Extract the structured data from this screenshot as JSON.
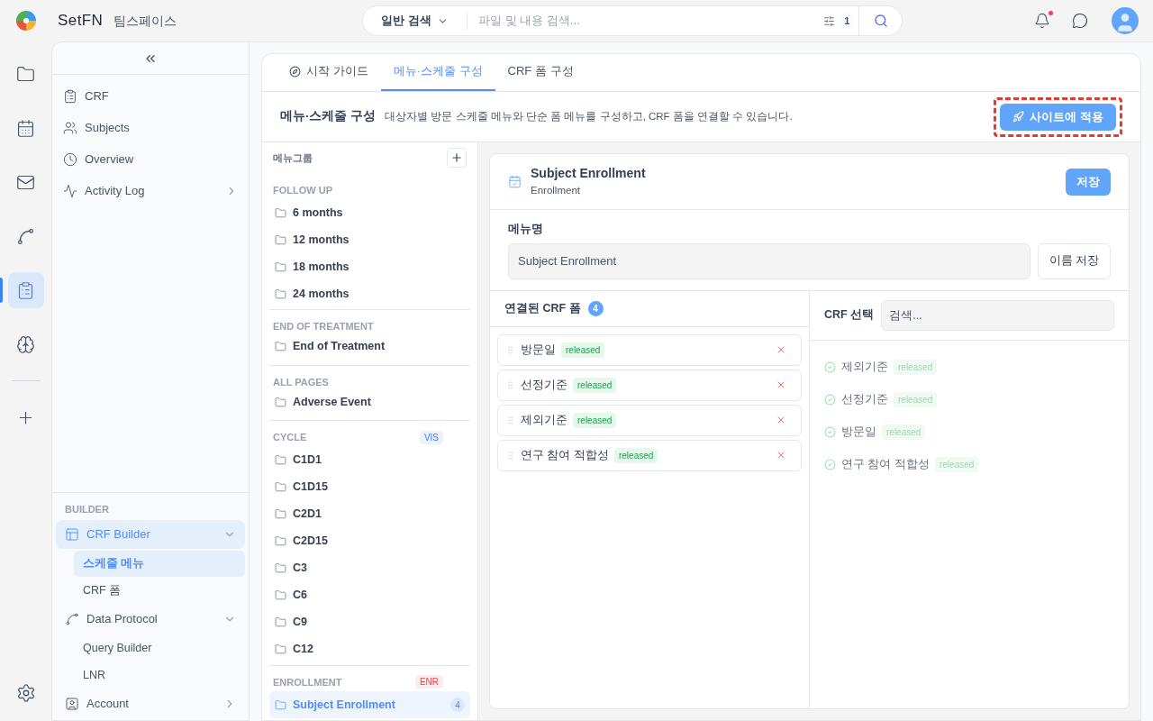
{
  "topbar": {
    "brand": "SetFN",
    "workspace": "팀스페이스",
    "search": {
      "mode": "일반 검색",
      "placeholder": "파일 및 내용 검색...",
      "filter_count": "1"
    },
    "notifications_unread": true
  },
  "rail": [
    {
      "kind": "folder",
      "selected": false
    },
    {
      "kind": "calendar",
      "selected": false
    },
    {
      "kind": "mail",
      "selected": false
    },
    {
      "kind": "route",
      "selected": false
    },
    {
      "kind": "clipboard",
      "selected": true
    },
    {
      "kind": "brain",
      "selected": false
    },
    {
      "kind": "plus",
      "selected": false
    }
  ],
  "sidebar": {
    "items": [
      {
        "label": "CRF",
        "kind": "clipboard"
      },
      {
        "label": "Subjects",
        "kind": "users"
      },
      {
        "label": "Overview",
        "kind": "clock"
      },
      {
        "label": "Activity Log",
        "kind": "activity",
        "expanded": false
      }
    ],
    "builder": {
      "heading": "BUILDER",
      "items": [
        {
          "label": "CRF Builder",
          "kind": "table",
          "selected": true,
          "expanded": true,
          "children": [
            {
              "label": "스케줄 메뉴",
              "selected": true
            },
            {
              "label": "CRF 폼",
              "selected": false
            }
          ]
        },
        {
          "label": "Data Protocol",
          "kind": "route",
          "selected": false,
          "expanded": true,
          "children": [
            {
              "label": "Query Builder",
              "selected": false
            },
            {
              "label": "LNR",
              "selected": false
            }
          ]
        },
        {
          "label": "Account",
          "kind": "user",
          "selected": false,
          "expanded": false
        }
      ]
    }
  },
  "tabs": [
    {
      "label": "시작 가이드",
      "kind": "guide",
      "selected": false
    },
    {
      "label": "메뉴·스케줄 구성",
      "kind": "plain",
      "selected": true
    },
    {
      "label": "CRF 폼 구성",
      "kind": "plain",
      "selected": false
    }
  ],
  "header": {
    "title": "메뉴·스케줄 구성",
    "description": "대상자별 방문 스케줄 메뉴와 단순 폼 메뉴를 구성하고, CRF 폼을 연결할 수 있습니다.",
    "apply_button": "사이트에 적용",
    "highlighted": true
  },
  "menu_groups": {
    "heading": "메뉴그룹",
    "groups": [
      {
        "title": "FOLLOW UP",
        "items": [
          {
            "label": "6 months",
            "selected": false
          },
          {
            "label": "12 months",
            "selected": false
          },
          {
            "label": "18 months",
            "selected": false
          },
          {
            "label": "24 months",
            "selected": false
          }
        ]
      },
      {
        "title": "END OF TREATMENT",
        "items": [
          {
            "label": "End of Treatment",
            "selected": false
          }
        ]
      },
      {
        "title": "ALL PAGES",
        "items": [
          {
            "label": "Adverse Event",
            "selected": false
          }
        ]
      },
      {
        "title": "CYCLE",
        "tag": "VIS",
        "color": "#3b82f6",
        "items": [
          {
            "label": "C1D1",
            "selected": false
          },
          {
            "label": "C1D15",
            "selected": false
          },
          {
            "label": "C2D1",
            "selected": false
          },
          {
            "label": "C2D15",
            "selected": false
          },
          {
            "label": "C3",
            "selected": false
          },
          {
            "label": "C6",
            "selected": false
          },
          {
            "label": "C9",
            "selected": false
          },
          {
            "label": "C12",
            "selected": false
          }
        ]
      },
      {
        "title": "ENROLLMENT",
        "tag": "ENR",
        "color": "#ef4444",
        "items": [
          {
            "label": "Subject Enrollment",
            "selected": true,
            "count": "4"
          }
        ]
      }
    ]
  },
  "detail": {
    "title": "Subject Enrollment",
    "subtitle": "Enrollment",
    "save_button": "저장",
    "name_label": "메뉴명",
    "name_value": "Subject Enrollment",
    "name_save_button": "이름 저장",
    "linked": {
      "title": "연결된 CRF 폼",
      "count": "4",
      "forms": [
        {
          "name": "방문일",
          "status": "released"
        },
        {
          "name": "선정기준",
          "status": "released"
        },
        {
          "name": "제외기준",
          "status": "released"
        },
        {
          "name": "연구 참여 적합성",
          "status": "released"
        }
      ]
    },
    "picker": {
      "label": "CRF 선택",
      "placeholder": "검색...",
      "forms": [
        {
          "name": "제외기준",
          "status": "released",
          "disabled": true
        },
        {
          "name": "선정기준",
          "status": "released",
          "disabled": true
        },
        {
          "name": "방문일",
          "status": "released",
          "disabled": true
        },
        {
          "name": "연구 참여 적합성",
          "status": "released",
          "disabled": true
        }
      ]
    }
  }
}
